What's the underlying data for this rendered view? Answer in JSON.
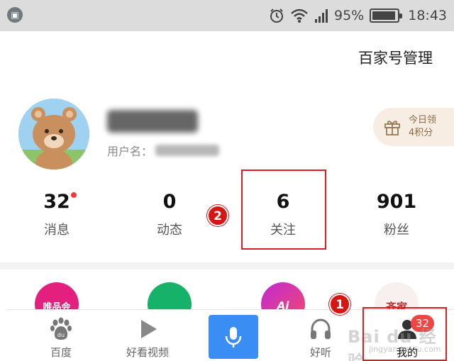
{
  "status_bar": {
    "battery": "95%",
    "time": "18:43",
    "battery_level": 0.95
  },
  "header": {
    "manage_link": "百家号管理"
  },
  "profile": {
    "username_label": "用户名："
  },
  "reward": {
    "line1": "今日领",
    "line2": "4积分"
  },
  "stats": [
    {
      "value": "32",
      "label": "消息"
    },
    {
      "value": "0",
      "label": "动态"
    },
    {
      "value": "6",
      "label": "关注"
    },
    {
      "value": "901",
      "label": "粉丝"
    }
  ],
  "annotations": {
    "step1": "1",
    "step2": "2"
  },
  "services": [
    {
      "text": "唯品会"
    },
    {
      "text": ""
    },
    {
      "text": "Ai"
    },
    {
      "text": "齐家"
    }
  ],
  "nav": [
    {
      "label": "百度"
    },
    {
      "label": "好看视频"
    },
    {
      "label": "好听"
    },
    {
      "label": "我的",
      "badge": "32"
    }
  ],
  "watermark": {
    "main": "Bai du 经验",
    "sub": "jingyan.baidu.com"
  },
  "colors": {
    "accent_blue": "#3a8df2",
    "badge_red": "#f04545",
    "annotation_red": "#d61515"
  }
}
